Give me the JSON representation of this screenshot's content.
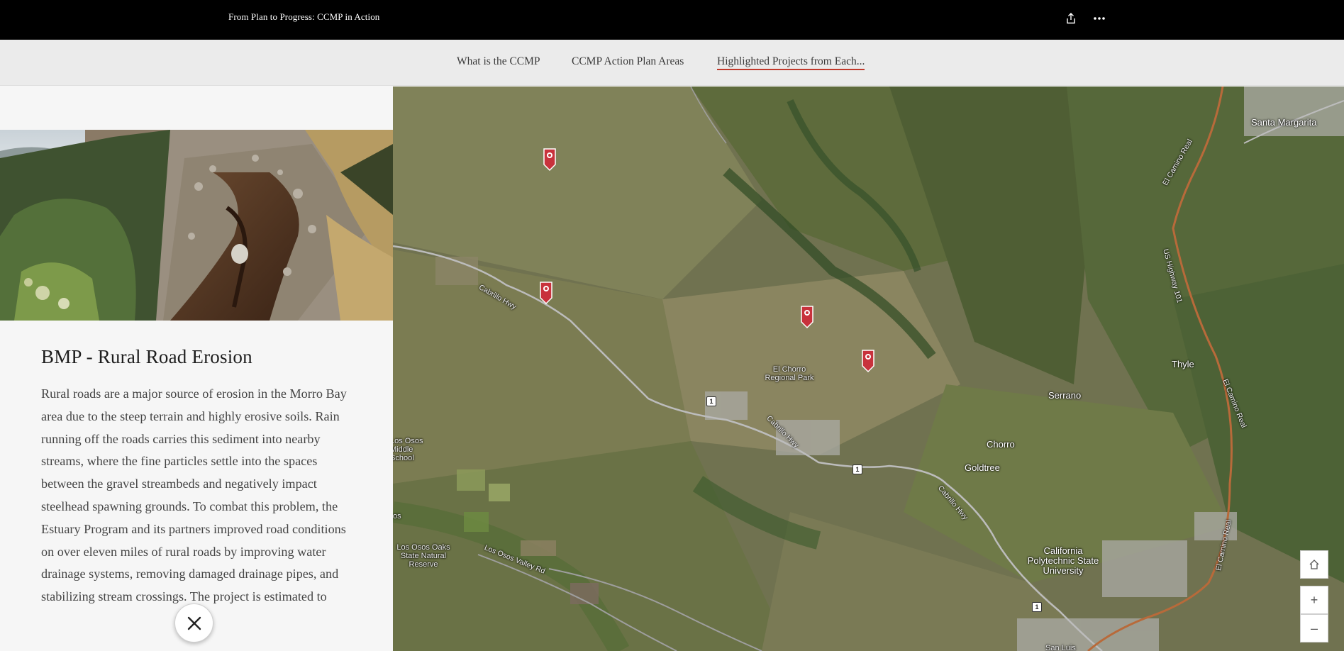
{
  "header": {
    "title": "From Plan to Progress: CCMP in Action",
    "share_icon": "share-icon",
    "more_icon": "more-horizontal-icon"
  },
  "nav": {
    "tabs": [
      {
        "label": "What is the CCMP"
      },
      {
        "label": "CCMP Action Plan Areas"
      },
      {
        "label": "Highlighted Projects from Each..."
      }
    ],
    "active_tab": 2,
    "accent_color": "#c0392b"
  },
  "panel": {
    "heading": "BMP - Rural Road Erosion",
    "body": "Rural roads are a major source of erosion in the Morro Bay area due to the steep terrain and highly erosive soils. Rain running off the roads carries this sediment into nearby streams, where the fine particles settle into the spaces between the gravel streambeds and negatively impact steelhead spawning grounds. To combat this problem, the Estuary Program and its partners improved road conditions on over eleven miles of rural roads by improving water drainage systems, removing damaged drainage pipes, and stabilizing stream crossings. The project is estimated to",
    "close_icon": "close-icon"
  },
  "map": {
    "labels": {
      "santa_margarita": "Santa Margarita",
      "el_camino_real_1": "El Camino Real",
      "el_camino_real_2": "El Camino Real",
      "el_camino_real_3": "El Camino Real",
      "us_highway": "US Highway 101",
      "thyle": "Thyle",
      "serrano": "Serrano",
      "chorro": "Chorro",
      "goldtree": "Goldtree",
      "el_chorro_park": "El Chorro Regional Park",
      "cabrillo_hwy_1": "Cabrillo Hwy",
      "cabrillo_hwy_2": "Cabrillo Hwy",
      "cabrillo_hwy_3": "Cabrillo Hwy",
      "cal_poly": "California Polytechnic State University",
      "los_osos_valley_rd": "Los Osos Valley Rd",
      "los_osos_middle_school": "Los Osos Middle School",
      "los_osos_oaks": "Los Osos Oaks State Natural Reserve",
      "los_edge": "os",
      "san_luis": "San Luis"
    },
    "route_shield": "1",
    "marker_color": "#c8323c",
    "controls": {
      "home_icon": "home-icon",
      "zoom_in": "+",
      "zoom_out": "–"
    }
  }
}
